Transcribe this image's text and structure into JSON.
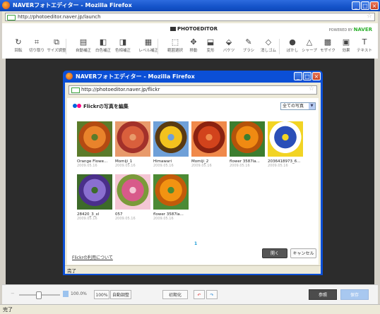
{
  "window": {
    "title": "NAVERフォトエディター - Mozilla Firefox",
    "url": "http://photoeditor.naver.jp/launch",
    "controls": {
      "minimize": "_",
      "maximize": "□",
      "close": "×"
    }
  },
  "app": {
    "logo": "PHOTOEDITOR",
    "powered_by": "POWERED BY",
    "brand": "NAVER"
  },
  "toolbar": [
    {
      "icon": "rotate-icon",
      "glyph": "↻",
      "label": "回転"
    },
    {
      "icon": "crop-icon",
      "glyph": "⌗",
      "label": "切り取り"
    },
    {
      "icon": "resize-icon",
      "glyph": "⧉",
      "label": "サイズ調整"
    },
    {
      "icon": "auto-correct-icon",
      "glyph": "▤",
      "label": "自動補正"
    },
    {
      "icon": "white-balance-icon",
      "glyph": "◧",
      "label": "白色補正"
    },
    {
      "icon": "color-correct-icon",
      "glyph": "◨",
      "label": "色相補正"
    },
    {
      "icon": "level-icon",
      "glyph": "▦",
      "label": "レベル補正"
    },
    {
      "icon": "select-range-icon",
      "glyph": "⬚",
      "label": "範囲選択"
    },
    {
      "icon": "move-icon",
      "glyph": "✥",
      "label": "移動"
    },
    {
      "icon": "transform-icon",
      "glyph": "⬓",
      "label": "変形"
    },
    {
      "icon": "bucket-icon",
      "glyph": "⬙",
      "label": "バケツ"
    },
    {
      "icon": "brush-icon",
      "glyph": "✎",
      "label": "ブラシ"
    },
    {
      "icon": "eraser-icon",
      "glyph": "◇",
      "label": "消しゴム"
    },
    {
      "icon": "blur-icon",
      "glyph": "●",
      "label": "ぼかし"
    },
    {
      "icon": "sharpen-icon",
      "glyph": "△",
      "label": "シャープ"
    },
    {
      "icon": "mosaic-icon",
      "glyph": "▩",
      "label": "モザイク"
    },
    {
      "icon": "effect-icon",
      "glyph": "▣",
      "label": "効果"
    },
    {
      "icon": "text-icon",
      "glyph": "T",
      "label": "テキスト"
    }
  ],
  "dialog": {
    "title": "NAVERフォトエディター - Mozilla Firefox",
    "url": "http://photoeditor.naver.jp/flickr",
    "heading": "Flickrの写真を編集",
    "filter": "全ての写真",
    "photos": [
      {
        "name": "Orange Flowe...",
        "date": "2009.05.16",
        "colors": [
          "#e9832b",
          "#b44a12",
          "#5b7b2a"
        ]
      },
      {
        "name": "Momiji_1",
        "date": "2009.05.16",
        "colors": [
          "#d95f3c",
          "#a3312a",
          "#e89a6b"
        ]
      },
      {
        "name": "Himawari",
        "date": "2009.05.16",
        "colors": [
          "#f3c21e",
          "#5a3a12",
          "#6fa0d8"
        ]
      },
      {
        "name": "Momiji_2",
        "date": "2009.05.16",
        "colors": [
          "#d2431c",
          "#8b2210",
          "#f0894a"
        ]
      },
      {
        "name": "flower 3587la...",
        "date": "2009.05.16",
        "colors": [
          "#f08a12",
          "#b5530a",
          "#3c7d2f"
        ]
      },
      {
        "name": "2036418973_6...",
        "date": "2009.05.16",
        "colors": [
          "#2a4fb8",
          "#ffffff",
          "#f2d424"
        ]
      },
      {
        "name": "28420_3_xl",
        "date": "2009.05.16",
        "colors": [
          "#8a6fd0",
          "#4a2f8a",
          "#3d6b2a"
        ]
      },
      {
        "name": "057",
        "date": "2009.05.16",
        "colors": [
          "#d85a8a",
          "#7b9a3a",
          "#f4c6d4"
        ]
      },
      {
        "name": "flower 3587la...",
        "date": "2009.05.16",
        "colors": [
          "#f29312",
          "#c25b0a",
          "#4c8a34"
        ]
      }
    ],
    "page": "1",
    "flickr_link": "Flickrの利用について",
    "open_label": "開く",
    "cancel_label": "キャンセル",
    "status": "完了"
  },
  "bottom": {
    "zoom": "100.0%",
    "zoom_reset": "100%",
    "auto_fit": "自動調整",
    "reset": "初期化",
    "undo": "↶",
    "redo": "↷",
    "browse": "参照",
    "save": "保存"
  },
  "status": "完了"
}
